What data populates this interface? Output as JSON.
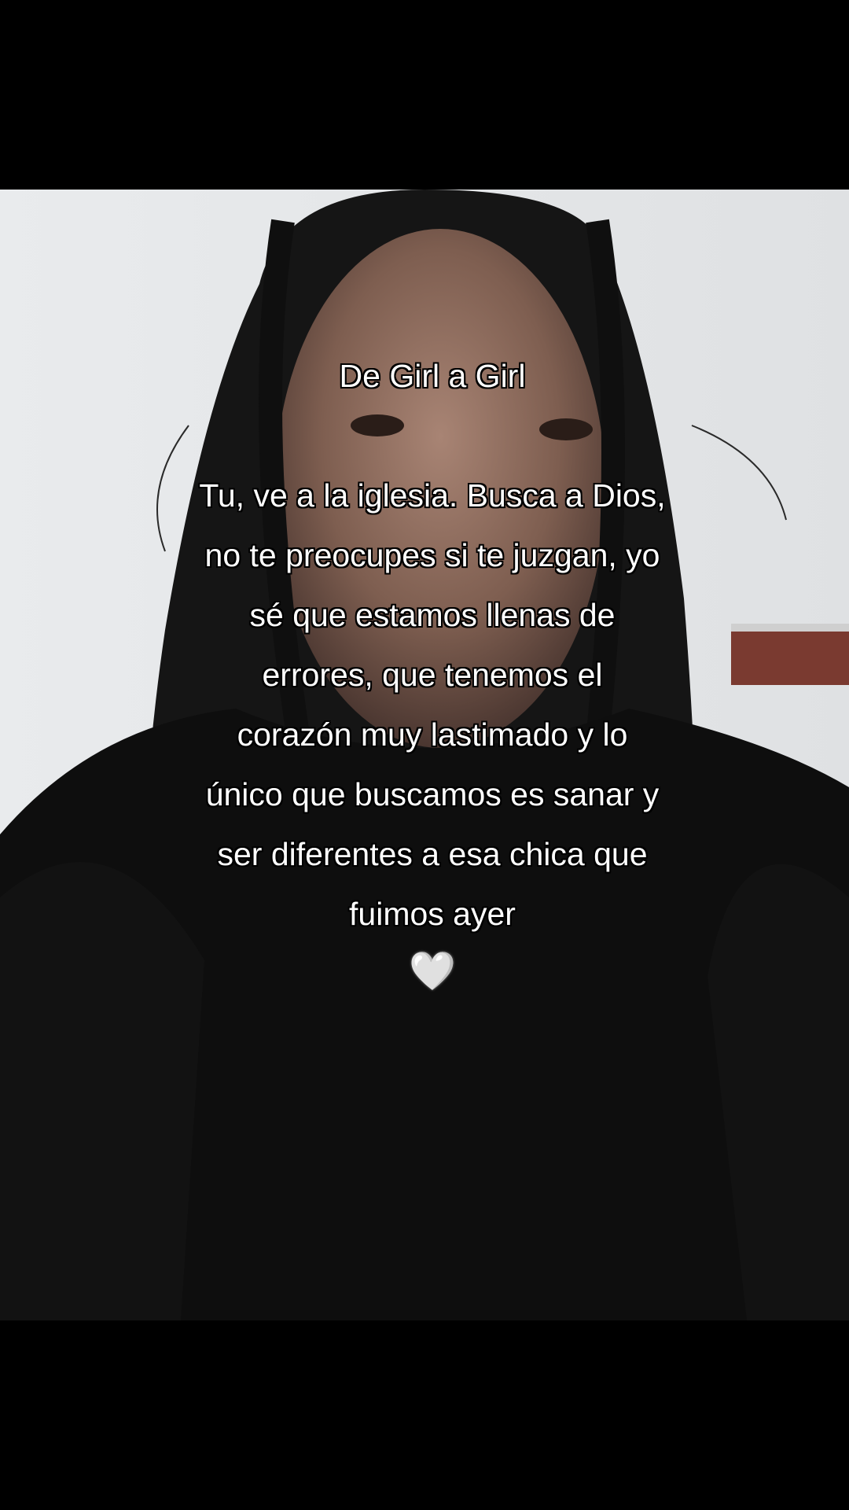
{
  "overlay": {
    "title": "De Girl a Girl",
    "lines": [
      "Tu, ve a la iglesia. Busca a Dios,",
      "no te preocupes si te juzgan, yo",
      "sé que estamos llenas de",
      "errores, que tenemos el",
      "corazón muy lastimado y lo",
      "único que buscamos es sanar y",
      "ser diferentes a esa chica que",
      "fuimos ayer"
    ],
    "emoji": "🤍"
  },
  "colors": {
    "background": "#000000",
    "wall": "#e6e7e9",
    "hair": "#141414",
    "skin": "#8a6a5a",
    "clothing": "#0d0d0d",
    "table": "#5a2a24",
    "text": "#ffffff"
  }
}
